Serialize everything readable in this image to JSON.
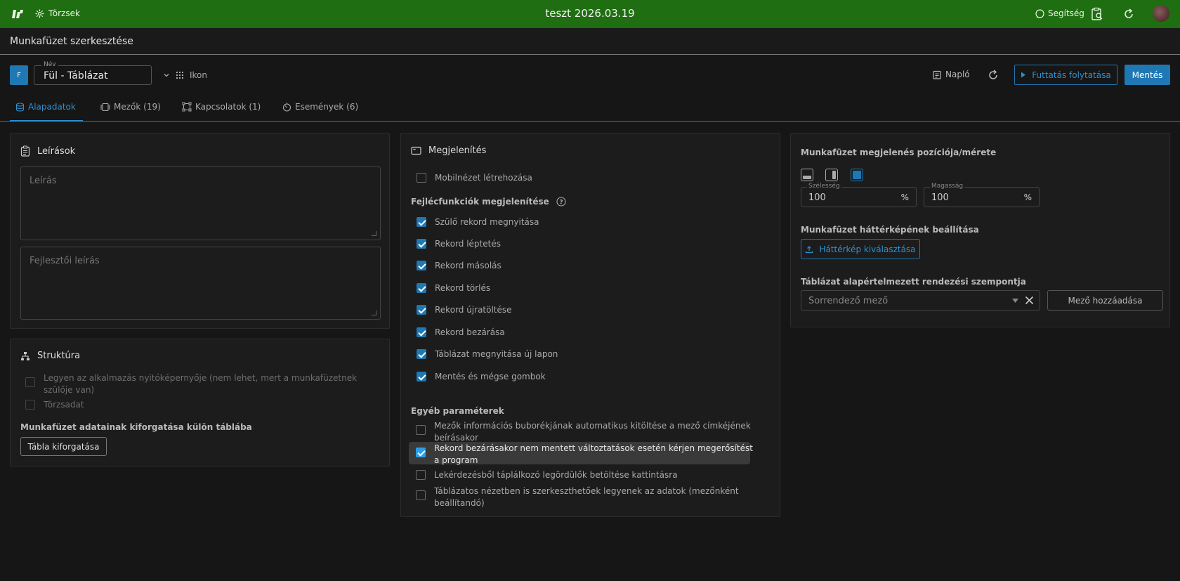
{
  "topbar": {
    "nav_label": "Törzsek",
    "title": "teszt 2026.03.19",
    "help_label": "Segítség",
    "icons": [
      "logo-icon",
      "settings-icon",
      "help-icon",
      "clipboard-search-icon",
      "refresh-icon",
      "avatar"
    ]
  },
  "header": {
    "title": "Munkafüzet szerkesztése"
  },
  "toolbar": {
    "badge": "F",
    "name_label": "Név",
    "name_value": "Fül - Táblázat",
    "icon_label": "Ikon",
    "log_label": "Napló",
    "run_label": "Futtatás folytatása",
    "save_label": "Mentés"
  },
  "tabs": [
    {
      "label": "Alapadatok",
      "active": true
    },
    {
      "label": "Mezők (19)",
      "active": false
    },
    {
      "label": "Kapcsolatok (1)",
      "active": false
    },
    {
      "label": "Események (6)",
      "active": false
    }
  ],
  "descriptions": {
    "title": "Leírások",
    "description_placeholder": "Leírás",
    "dev_description_placeholder": "Fejlesztői leírás"
  },
  "structure": {
    "title": "Struktúra",
    "checkboxes": [
      {
        "label": "Legyen az alkalmazás nyitóképernyője (nem lehet, mert a munkafüzetnek szülője van)",
        "checked": false,
        "disabled": true
      },
      {
        "label": "Törzsadat",
        "checked": false,
        "disabled": true
      }
    ],
    "split_label": "Munkafüzet adatainak kiforgatása külön táblába",
    "split_button": "Tábla kiforgatása"
  },
  "display": {
    "title": "Megjelenítés",
    "mobile_label": "Mobilnézet létrehozása",
    "mobile_checked": false,
    "header_functions_label": "Fejlécfunkciók megjelenítése",
    "header_functions": [
      {
        "label": "Szülő rekord megnyitása",
        "checked": true
      },
      {
        "label": "Rekord léptetés",
        "checked": true
      },
      {
        "label": "Rekord másolás",
        "checked": true
      },
      {
        "label": "Rekord törlés",
        "checked": true
      },
      {
        "label": "Rekord újratöltése",
        "checked": true
      },
      {
        "label": "Rekord bezárása",
        "checked": true
      },
      {
        "label": "Táblázat megnyitása új lapon",
        "checked": true
      },
      {
        "label": "Mentés és mégse gombok",
        "checked": true
      }
    ],
    "other_params_label": "Egyéb paraméterek",
    "other_params": [
      {
        "label": "Mezők információs buborékjának automatikus kitöltése a mező címkéjének beírásakor",
        "checked": false
      },
      {
        "label": "Rekord bezárásakor nem mentett változtatások esetén kérjen megerősítést a program",
        "checked": true
      },
      {
        "label": "Lekérdezésből táplálkozó legördülők betöltése kattintásra",
        "checked": false
      },
      {
        "label": "Táblázatos nézetben is szerkeszthetőek legyenek az adatok (mezőnként beállítandó)",
        "checked": false
      }
    ]
  },
  "position": {
    "title": "Munkafüzet megjelenés pozíciója/mérete",
    "width_label": "Szélesség",
    "width_value": "100",
    "height_label": "Magasság",
    "height_value": "100",
    "unit": "%",
    "bg_title": "Munkafüzet háttérképének beállítása",
    "bg_button": "Háttérkép kiválasztása",
    "sort_title": "Táblázat alapértelmezett rendezési szempontja",
    "sort_placeholder": "Sorrendező mező",
    "add_field_button": "Mező hozzáadása"
  },
  "colors": {
    "topbar": "#1f6e11",
    "accent": "#1e78b4",
    "background": "#161616"
  }
}
